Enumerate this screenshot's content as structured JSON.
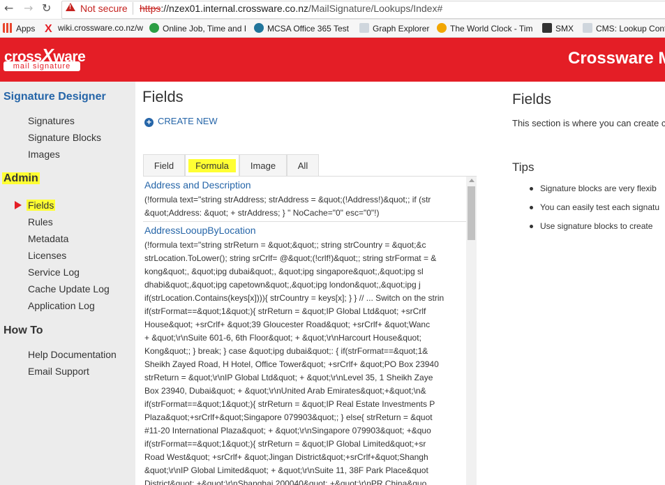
{
  "browser": {
    "security_label": "Not secure",
    "url_scheme": "https",
    "url_host": "://nzex01.internal.crossware.co.nz",
    "url_path": "/MailSignature/Lookups/Index#"
  },
  "bookmarks": [
    {
      "label": "Apps",
      "color": "#e8442c"
    },
    {
      "label": "wiki.crossware.co.nz/w",
      "color": "#e41e26"
    },
    {
      "label": "Online Job, Time and I",
      "color": "#2d9e44"
    },
    {
      "label": "MCSA Office 365 Test",
      "color": "#21759b"
    },
    {
      "label": "Graph Explorer",
      "color": "#7f8c9a"
    },
    {
      "label": "The World Clock - Tim",
      "color": "#f2a600"
    },
    {
      "label": "SMX",
      "color": "#333333"
    },
    {
      "label": "CMS: Lookup Conf",
      "color": "#7f8c9a"
    }
  ],
  "header": {
    "logo_top_a": "cross",
    "logo_top_x": "X",
    "logo_top_b": "ware",
    "logo_sub": "mail signature",
    "title": "Crossware M"
  },
  "sidebar": {
    "section_designer": "Signature Designer",
    "designer_items": [
      "Signatures",
      "Signature Blocks",
      "Images"
    ],
    "section_admin": "Admin",
    "admin_items": [
      "Fields",
      "Rules",
      "Metadata",
      "Licenses",
      "Service Log",
      "Cache Update Log",
      "Application Log"
    ],
    "section_howto": "How To",
    "howto_items": [
      "Help Documentation",
      "Email Support"
    ]
  },
  "main": {
    "title": "Fields",
    "create_new": "CREATE NEW",
    "tabs": [
      "Field",
      "Formula",
      "Image",
      "All"
    ],
    "entries": [
      {
        "title": "Address and Description",
        "lines": [
          "(!formula text=\"string strAddress; strAddress = &quot;(!Address!)&quot;; if (str",
          "&quot;Address: &quot; + strAddress; } \" NoCache=\"0\" esc=\"0\"!)"
        ]
      },
      {
        "title": "AddressLooupByLocation",
        "lines": [
          "(!formula text=\"string strReturn = &quot;&quot;; string strCountry = &quot;&c",
          "strLocation.ToLower(); string srCrlf= @&quot;(!crlf!)&quot;; string strFormat = &",
          "kong&quot;, &quot;ipg dubai&quot;, &quot;ipg singapore&quot;,&quot;ipg sl",
          "dhabi&quot;,&quot;ipg capetown&quot;,&quot;ipg london&quot;,&quot;ipg j",
          "if(strLocation.Contains(keys[x]))){ strCountry = keys[x]; } } // ... Switch on the strin",
          "if(strFormat==&quot;1&quot;){ strReturn = &quot;IP Global Ltd&quot; +srCrlf",
          "House&quot; +srCrlf+ &quot;39 Gloucester Road&quot; +srCrlf+ &quot;Wanc",
          "+ &quot;\\r\\nSuite 601-6, 6th Floor&quot; + &quot;\\r\\nHarcourt House&quot;",
          "Kong&quot;; } break; } case &quot;ipg dubai&quot;: { if(strFormat==&quot;1&",
          "Sheikh Zayed Road, H Hotel, Office Tower&quot; +srCrlf+ &quot;PO Box 23940",
          "strReturn = &quot;\\r\\nIP Global Ltd&quot; + &quot;\\r\\nLevel 35, 1 Sheikh Zaye",
          "Box 23940, Dubai&quot; + &quot;\\r\\nUnited Arab Emirates&quot;+&quot;\\n&",
          "if(strFormat==&quot;1&quot;){ strReturn = &quot;IP Real Estate Investments P",
          "Plaza&quot;+srCrlf+&quot;Singapore 079903&quot;; } else{ strReturn = &quot",
          "#11-20 International Plaza&quot; + &quot;\\r\\nSingapore 079903&quot; +&quo",
          "if(strFormat==&quot;1&quot;){ strReturn = &quot;IP Global Limited&quot;+sr",
          "Road West&quot; +srCrlf+ &quot;Jingan District&quot;+srCrlf+&quot;Shangh",
          "&quot;\\r\\nIP Global Limited&quot; + &quot;\\r\\nSuite 11, 38F Park Place&quot",
          "District&quot; +&quot;\\r\\nShanghai 200040&quot; +&quot;\\r\\nPR China&quo"
        ]
      }
    ]
  },
  "right_panel": {
    "title": "Fields",
    "text": "This section is where you can create c",
    "tips_title": "Tips",
    "tips": [
      "Signature blocks are very flexib",
      "You can easily test each signatu",
      "Use signature blocks to create"
    ]
  }
}
